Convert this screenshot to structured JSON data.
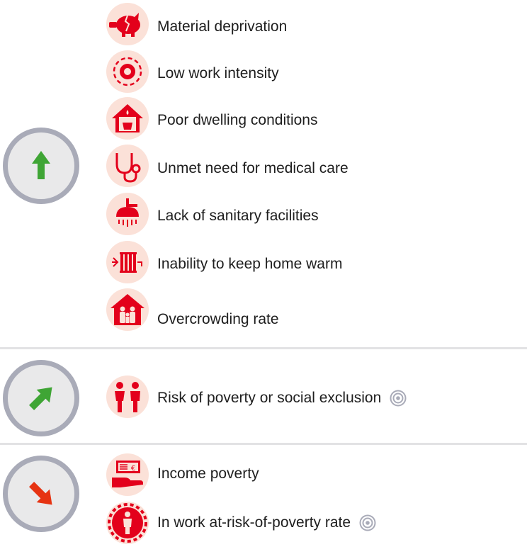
{
  "colors": {
    "icon_red": "#e3001b",
    "icon_bg": "#fbe1d8",
    "trend_circle_bg": "#e9e9ea",
    "trend_circle_border": "#a9abb8",
    "arrow_green": "#3fa535",
    "arrow_red": "#e63312",
    "divider": "#e2e2e4"
  },
  "groups": [
    {
      "trend": "up",
      "trend_icon": "arrow-up-icon",
      "items": [
        {
          "label": "Material deprivation",
          "icon": "piggy-bank-icon"
        },
        {
          "label": "Low work intensity",
          "icon": "gear-icon"
        },
        {
          "label": "Poor dwelling conditions",
          "icon": "leaking-house-icon"
        },
        {
          "label": "Unmet need for medical care",
          "icon": "stethoscope-icon"
        },
        {
          "label": "Lack of sanitary facilities",
          "icon": "shower-icon"
        },
        {
          "label": "Inability to keep home warm",
          "icon": "radiator-icon"
        },
        {
          "label": "Overcrowding rate",
          "icon": "family-house-icon"
        }
      ]
    },
    {
      "trend": "up-right",
      "trend_icon": "arrow-up-right-icon",
      "items": [
        {
          "label": "Risk of poverty or social exclusion",
          "icon": "people-icon",
          "target_icon": "target-icon"
        }
      ]
    },
    {
      "trend": "down-right",
      "trend_icon": "arrow-down-right-icon",
      "items": [
        {
          "label": "Income poverty",
          "icon": "euro-banknote-hand-icon"
        },
        {
          "label": "In work at-risk-of-poverty rate",
          "icon": "worker-gear-icon",
          "target_icon": "target-icon"
        }
      ]
    }
  ]
}
